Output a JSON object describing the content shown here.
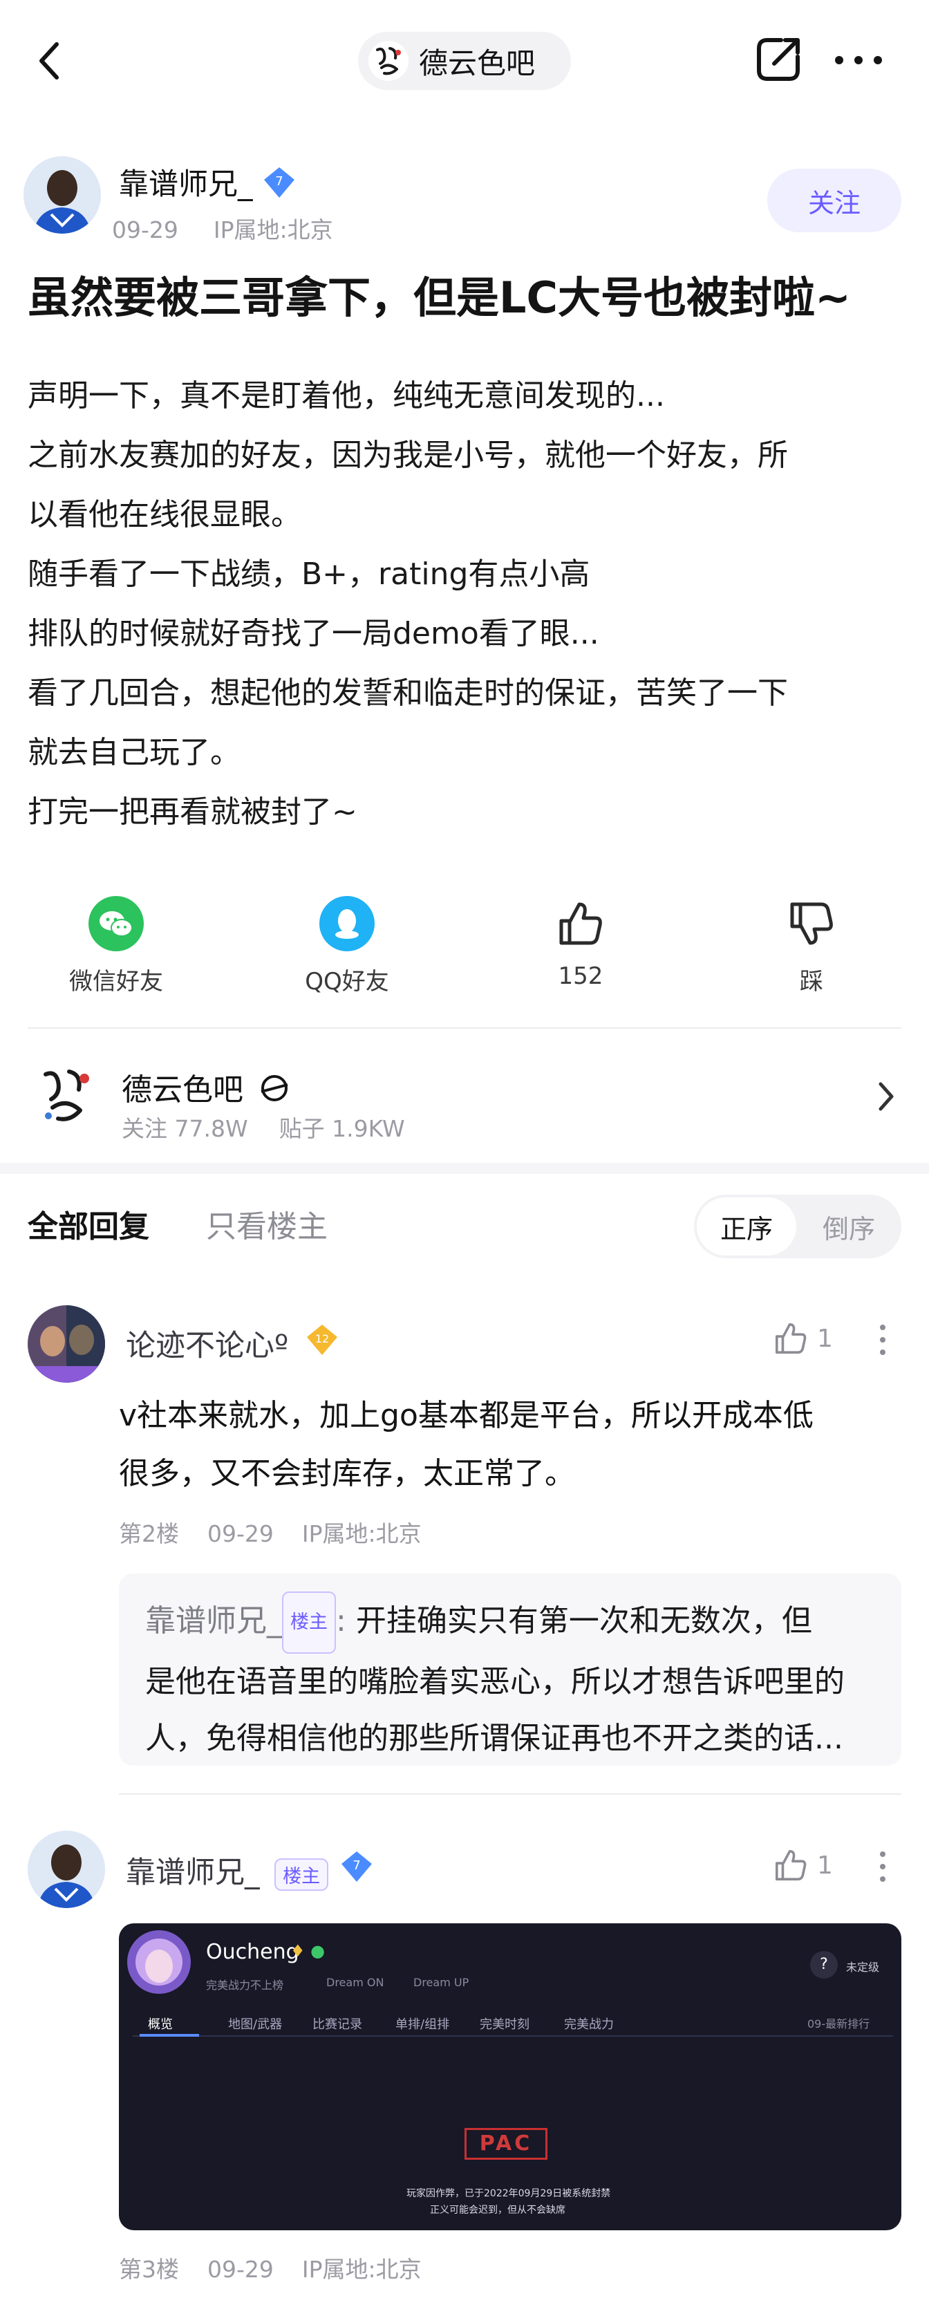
{
  "header": {
    "forum_pill_label": "德云色吧",
    "back_icon": "chevron-left-icon",
    "share_icon": "share-icon",
    "more_icon": "more-icon"
  },
  "post": {
    "author": "靠谱师兄_",
    "author_level": "7",
    "date": "09-29",
    "ip": "IP属地:北京",
    "follow_label": "关注",
    "title": "虽然要被三哥拿下，但是LC大号也被封啦~",
    "body_lines": [
      "声明一下，真不是盯着他，纯纯无意间发现的...",
      "之前水友赛加的好友，因为我是小号，就他一个好友，所",
      "以看他在线很显眼。",
      "随手看了一下战绩，B+，rating有点小高",
      "排队的时候就好奇找了一局demo看了眼...",
      "看了几回合，想起他的发誓和临走时的保证，苦笑了一下",
      "就去自己玩了。",
      "打完一把再看就被封了~"
    ]
  },
  "share_row": {
    "wechat": "微信好友",
    "qq": "QQ好友",
    "likes": "152",
    "dislike": "踩"
  },
  "forum_card": {
    "name": "德云色吧",
    "followers": "关注 77.8W",
    "posts": "贴子 1.9KW"
  },
  "tabs": {
    "all": "全部回复",
    "op_only": "只看楼主",
    "order_asc": "正序",
    "order_desc": "倒序"
  },
  "replies": [
    {
      "user": "论迹不论心º",
      "level": "12",
      "likes": "1",
      "text_lines": [
        "v社本来就水，加上go基本都是平台，所以开成本低",
        "很多，又不会封库存，太正常了。"
      ],
      "floor": "第2楼",
      "date": "09-29",
      "ip": "IP属地:北京",
      "sub_reply": {
        "user": "靠谱师兄_",
        "tag": "楼主",
        "sep": ":",
        "lines": [
          "开挂确实只有第一次和无数次，但",
          "是他在语音里的嘴脸着实恶心，所以才想告诉吧里的",
          "人，免得相信他的那些所谓保证再也不开之类的话..."
        ]
      }
    },
    {
      "user": "靠谱师兄_",
      "tag": "楼主",
      "level": "7",
      "likes": "1",
      "floor": "第3楼",
      "date": "09-29",
      "ip": "IP属地:北京",
      "image": {
        "player": "Oucheng",
        "subtitle_1": "完美战力不上榜",
        "subtitle_2": "Dream ON",
        "subtitle_3": "Dream UP",
        "badge": "未定级",
        "tabs": [
          "概览",
          "地图/武器",
          "比赛记录",
          "单排/组排",
          "完美时刻",
          "完美战力"
        ],
        "season": "09-最新排行",
        "ban_stamp": "PAC",
        "ban_line_1": "玩家因作弊，已于2022年09月29日被系统封禁",
        "ban_line_2": "正义可能会迟到，但从不会缺席"
      }
    }
  ]
}
